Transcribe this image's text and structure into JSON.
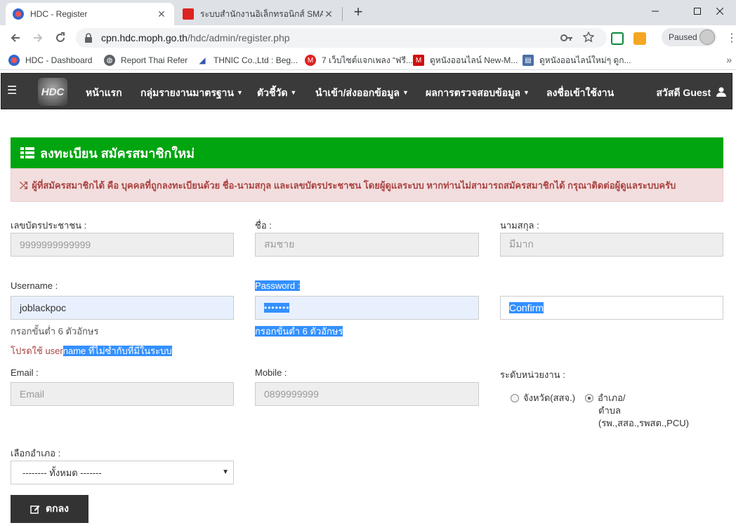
{
  "browser": {
    "tabs": [
      {
        "title": "HDC - Register",
        "close": "✕"
      },
      {
        "title": "ระบบสำนักงานอิเล็กทรอนิกส์ SMART O",
        "close": "✕"
      }
    ],
    "new_tab": "+",
    "url_host": "cpn.hdc.moph.go.th",
    "url_path": "/hdc/admin/register.php",
    "profile_status": "Paused",
    "bookmarks": [
      {
        "label": "HDC - Dashboard"
      },
      {
        "label": "Report Thai Refer"
      },
      {
        "label": "THNIC Co.,Ltd : Beg..."
      },
      {
        "label": "7 เว็บไซต์แจกเพลง “ฟรี..."
      },
      {
        "label": "ดูหนังออนไลน์ New-M..."
      },
      {
        "label": "ดูหนังออนไลน์ใหม่ๆ ดูก..."
      }
    ],
    "bookmarks_more": "»"
  },
  "site": {
    "logo_text": "HDC",
    "nav": [
      {
        "label": "หน้าแรก",
        "dropdown": false
      },
      {
        "label": "กลุ่มรายงานมาตรฐาน",
        "dropdown": true
      },
      {
        "label": "ตัวชี้วัด",
        "dropdown": true
      },
      {
        "label": "นำเข้า/ส่งออกข้อมูล",
        "dropdown": true
      },
      {
        "label": "ผลการตรวจสอบข้อมูล",
        "dropdown": true
      },
      {
        "label": "ลงชื่อเข้าใช้งาน",
        "dropdown": false
      }
    ],
    "greeting": "สวัสดี Guest"
  },
  "panel": {
    "title": "ลงทะเบียน สมัครสมาชิกใหม่",
    "notice": "ผู้ที่สมัครสมาชิกได้ คือ บุคคลที่ถูกลงทะเบียนด้วย ชื่อ-นามสกุล และเลขบัตรประชาชน โดยผู้ดูแลระบบ หากท่านไม่สามารถสมัครสมาชิกได้ กรุณาติดต่อผู้ดูแลระบบครับ"
  },
  "form": {
    "cid_label": "เลขบัตรประชาชน :",
    "cid_placeholder": "9999999999999",
    "fname_label": "ชื่อ :",
    "fname_placeholder": "สมชาย",
    "lname_label": "นามสกุล :",
    "lname_placeholder": "มีมาก",
    "username_label": "Username :",
    "username_value": "joblackpoc",
    "username_hint": "กรอกขั้นต่ำ 6 ตัวอักษร",
    "username_warn_a": "โปรดใช้ user",
    "username_warn_b": "name ที่ไม่ซ้ำกับที่มีในระบบ",
    "password_label": "Password :",
    "password_value": "•••••••",
    "password_hint": "กรอกขั้นต่ำ 6 ตัวอักษร",
    "confirm_placeholder": "Confirm",
    "email_label": "Email :",
    "email_placeholder": "Email",
    "mobile_label": "Mobile :",
    "mobile_placeholder": "0899999999",
    "level_label": "ระดับหน่วยงาน :",
    "level_opt1": "จังหวัด(สสจ.)",
    "level_opt2_line1": "อำเภอ/",
    "level_opt2_line2": "ตำบล",
    "level_opt2_line3": "(รพ.,สสอ.,รพสต.,PCU)",
    "district_label": "เลือกอำเภอ :",
    "district_value": "-------- ทั้งหมด -------",
    "submit_label": "ตกลง"
  }
}
